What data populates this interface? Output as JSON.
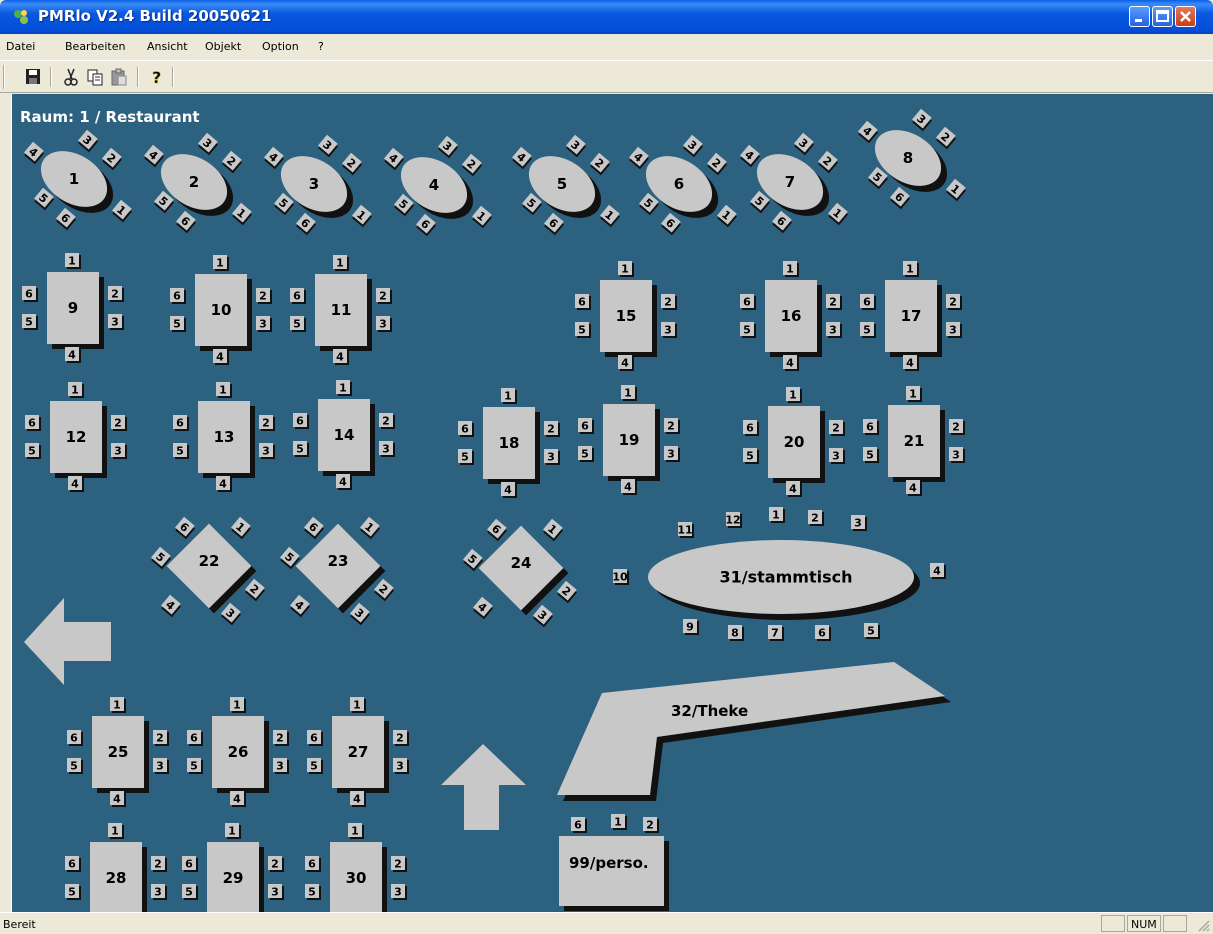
{
  "window": {
    "title": "PMRlo V2.4 Build 20050621"
  },
  "menu": [
    "Datei",
    "Bearbeiten",
    "Ansicht",
    "Objekt",
    "Option",
    "?"
  ],
  "toolbar": {
    "buttons": [
      "save-icon",
      "cut-icon",
      "copy-icon",
      "paste-icon",
      "help-icon"
    ]
  },
  "room": {
    "title": "Raum: 1 / Restaurant"
  },
  "tables": {
    "oval": [
      "1",
      "2",
      "3",
      "4",
      "5",
      "6",
      "7",
      "8"
    ],
    "rect": [
      "9",
      "10",
      "11",
      "15",
      "16",
      "17",
      "12",
      "13",
      "14",
      "18",
      "19",
      "20",
      "21",
      "25",
      "26",
      "27",
      "28",
      "29",
      "30"
    ],
    "diamond": [
      "22",
      "23",
      "24"
    ],
    "stammtisch": "31/stammtisch",
    "theke": "32/Theke",
    "perso": "99/perso."
  },
  "seats": {
    "oval": [
      "1",
      "2",
      "3",
      "4",
      "5",
      "6"
    ],
    "rect": [
      "1",
      "2",
      "3",
      "4",
      "5",
      "6"
    ],
    "stammtisch": [
      "1",
      "2",
      "3",
      "4",
      "5",
      "6",
      "7",
      "8",
      "9",
      "10",
      "11",
      "12"
    ],
    "perso": [
      "6",
      "1",
      "2"
    ]
  },
  "status": {
    "text": "Bereit",
    "num": "NUM"
  },
  "colors": {
    "canvas": "#2C6180",
    "table": "#C8C8C8",
    "shadow": "#111111"
  }
}
